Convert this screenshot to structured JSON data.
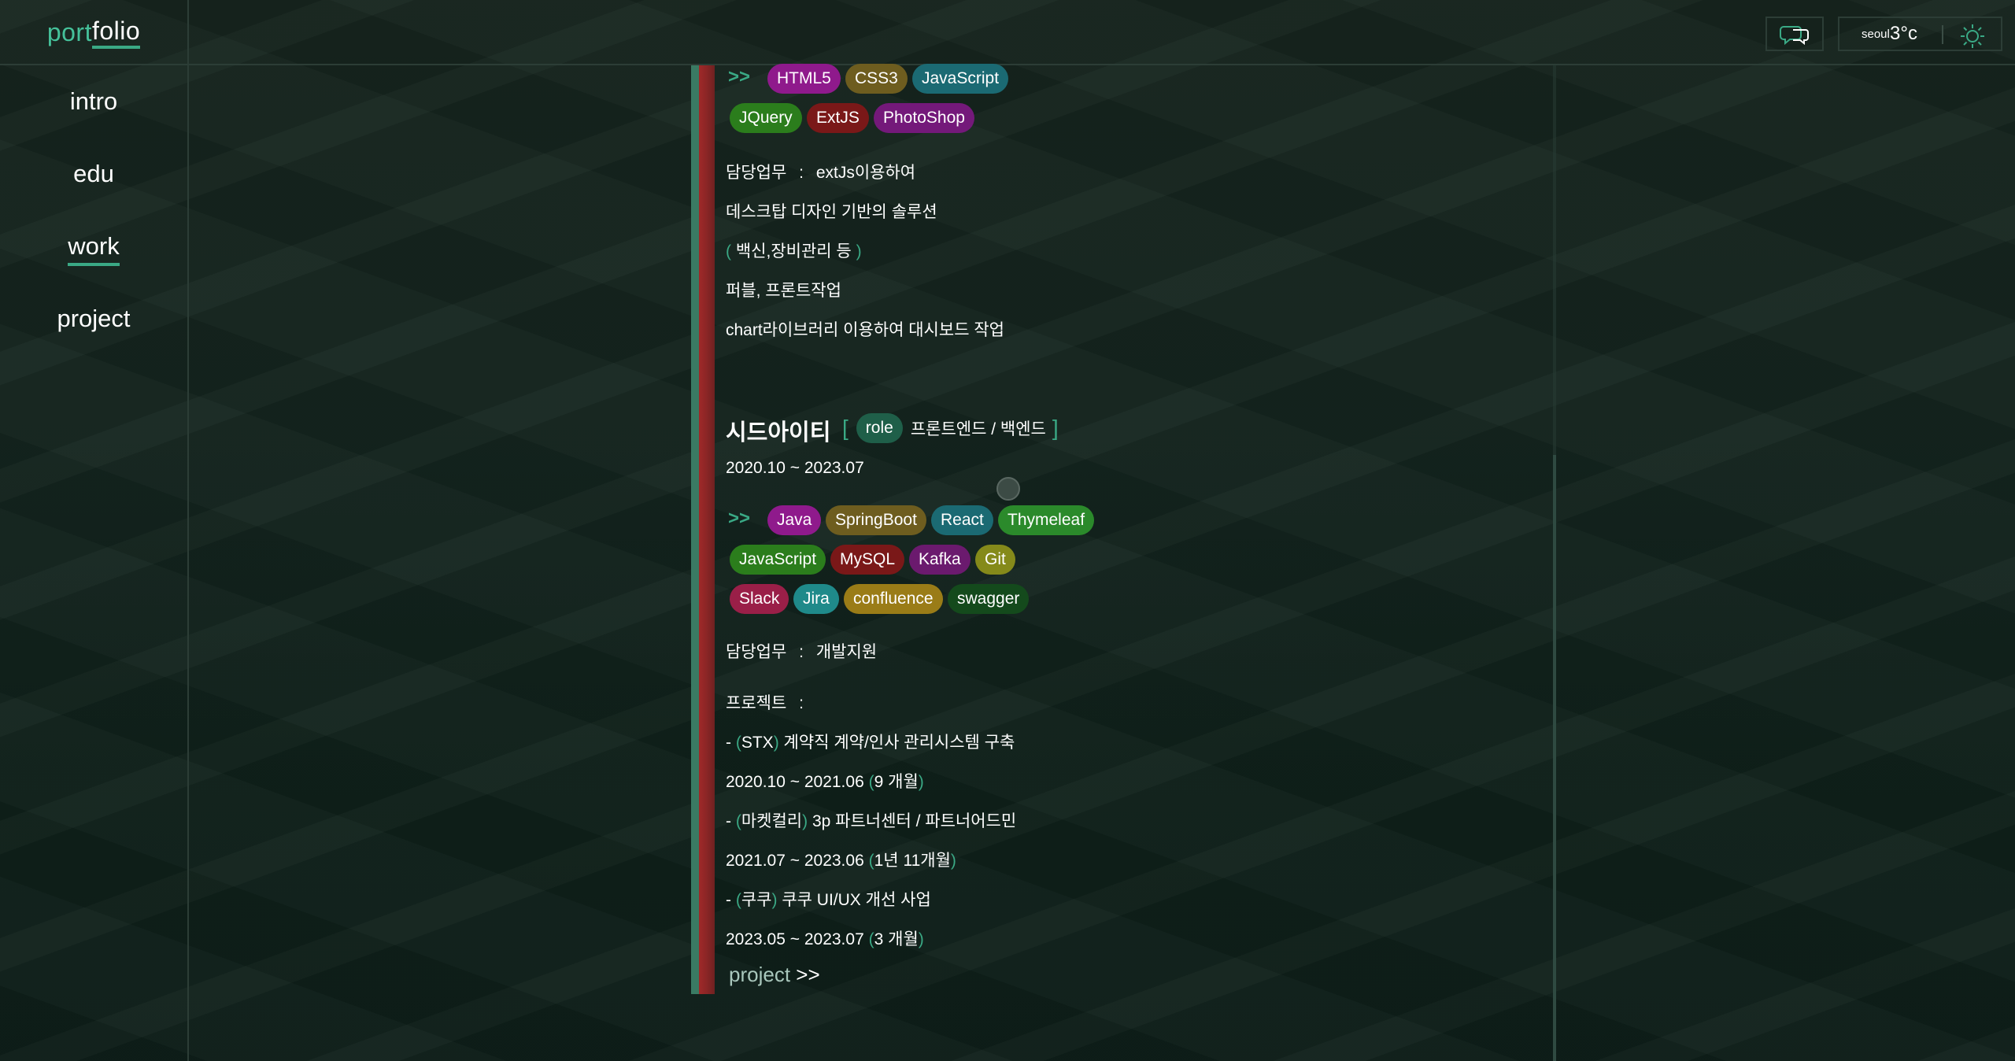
{
  "header": {
    "logo_part1": "port",
    "logo_part2": "folio",
    "weather": {
      "city": "seoul",
      "temp": "3°c"
    },
    "icons": [
      "chat-bubbles-icon",
      "sun-icon"
    ]
  },
  "sidebar": {
    "items": [
      {
        "label": "intro",
        "active": false
      },
      {
        "label": "edu",
        "active": false
      },
      {
        "label": "work",
        "active": true
      },
      {
        "label": "project",
        "active": false
      }
    ]
  },
  "job1": {
    "arrows": ">>",
    "tags_row1": [
      {
        "label": "HTML5",
        "color": "#8f1a8c"
      },
      {
        "label": "CSS3",
        "color": "#6e5d1f"
      },
      {
        "label": "JavaScript",
        "color": "#1b6a73"
      }
    ],
    "tags_row2": [
      {
        "label": "JQuery",
        "color": "#2b7d1c"
      },
      {
        "label": "ExtJS",
        "color": "#7a1818"
      },
      {
        "label": "PhotoShop",
        "color": "#74197a"
      }
    ],
    "duty_label": "담당업무",
    "colon": ":",
    "duty_value": "extJs이용하여",
    "desc1": "데스크탑 디자인 기반의 솔루션",
    "desc2_open": "(",
    "desc2": "백신,장비관리 등",
    "desc2_close": ")",
    "desc3": "퍼블, 프론트작업",
    "desc4": "chart라이브러리 이용하여 대시보드 작업"
  },
  "job2": {
    "company": "시드아이티",
    "bracket_open": "[",
    "role_label": "role",
    "role_value": "프론트엔드 / 백엔드",
    "bracket_close": "]",
    "period": "2020.10 ~ 2023.07",
    "arrows": ">>",
    "tags_row1": [
      {
        "label": "Java",
        "color": "#8f1a8c"
      },
      {
        "label": "SpringBoot",
        "color": "#6e5d1f"
      },
      {
        "label": "React",
        "color": "#1b6a73"
      },
      {
        "label": "Thymeleaf",
        "color": "#2b8a2b"
      }
    ],
    "tags_row2": [
      {
        "label": "JavaScript",
        "color": "#2b7d1c"
      },
      {
        "label": "MySQL",
        "color": "#7a1818"
      },
      {
        "label": "Kafka",
        "color": "#6b1a6e"
      },
      {
        "label": "Git",
        "color": "#858a1a"
      }
    ],
    "tags_row3": [
      {
        "label": "Slack",
        "color": "#9a1f48"
      },
      {
        "label": "Jira",
        "color": "#1f8a8a"
      },
      {
        "label": "confluence",
        "color": "#9a7c17"
      },
      {
        "label": "swagger",
        "color": "#144a1c"
      }
    ],
    "duty_label": "담당업무",
    "colon": ":",
    "duty_value": "개발지원",
    "projects_label": "프로젝트",
    "projects": [
      {
        "dash": "-",
        "client": "STX",
        "name": "계약직 계약/인사 관리시스템 구축",
        "period": "2020.10 ~ 2021.06",
        "duration": "9 개월"
      },
      {
        "dash": "-",
        "client": "마켓컬리",
        "name": "3p 파트너센터 / 파트너어드민",
        "period": "2021.07 ~ 2023.06",
        "duration": "1년 11개월"
      },
      {
        "dash": "-",
        "client": "쿠쿠",
        "name": "쿠쿠 UI/UX 개선 사업",
        "period": "2023.05 ~ 2023.07",
        "duration": "3 개월"
      }
    ],
    "paren_open": "(",
    "paren_close": ")"
  },
  "project_link": {
    "label": "project",
    "arrows": ">>"
  }
}
